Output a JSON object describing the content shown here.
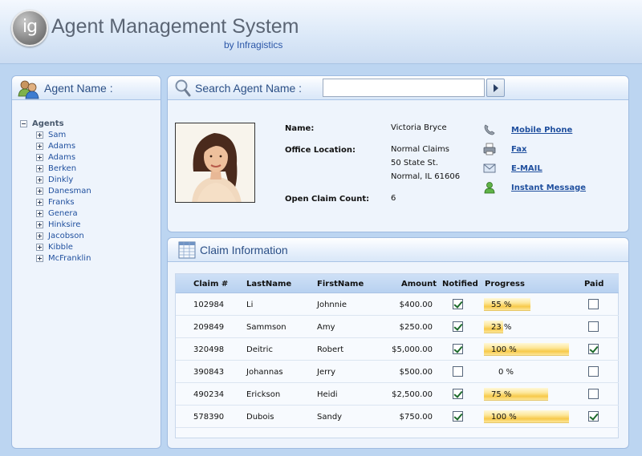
{
  "header": {
    "logo_text": "ig",
    "title": "Agent Management System",
    "subtitle": "by Infragistics"
  },
  "left_panel": {
    "title": "Agent Name :",
    "tree_root": "Agents",
    "agents": [
      "Sam",
      "Adams",
      "Adams",
      "Berken",
      "Dinkly",
      "Danesman",
      "Franks",
      "Genera",
      "Hinksire",
      "Jacobson",
      "Kibble",
      "McFranklin"
    ]
  },
  "search": {
    "title": "Search Agent Name :",
    "value": "",
    "placeholder": ""
  },
  "agent": {
    "name_label": "Name:",
    "name": "Victoria Bryce",
    "office_label": "Office Location:",
    "office_line1": "Normal Claims",
    "office_line2": "50 State St.",
    "office_line3": "Normal, IL 61606",
    "claims_label": "Open Claim Count:",
    "claims": "6"
  },
  "contacts": [
    {
      "label": "Mobile Phone",
      "icon": "phone-icon"
    },
    {
      "label": "Fax",
      "icon": "fax-icon"
    },
    {
      "label": "E-MAIL",
      "icon": "email-icon"
    },
    {
      "label": "Instant Message",
      "icon": "instant-message-icon"
    }
  ],
  "claims": {
    "title": "Claim Information",
    "columns": [
      "Claim #",
      "LastName",
      "FirstName",
      "Amount",
      "Notified",
      "Progress",
      "Paid"
    ],
    "rows": [
      {
        "claim": "102984",
        "last": "Li",
        "first": "Johnnie",
        "amount": "$400.00",
        "notified": true,
        "progress": 55,
        "progress_text": "55 %",
        "paid": false
      },
      {
        "claim": "209849",
        "last": "Sammson",
        "first": "Amy",
        "amount": "$250.00",
        "notified": true,
        "progress": 23,
        "progress_text": "23 %",
        "paid": false
      },
      {
        "claim": "320498",
        "last": "Deitric",
        "first": "Robert",
        "amount": "$5,000.00",
        "notified": true,
        "progress": 100,
        "progress_text": "100 %",
        "paid": true
      },
      {
        "claim": "390843",
        "last": "Johannas",
        "first": "Jerry",
        "amount": "$500.00",
        "notified": false,
        "progress": 0,
        "progress_text": "0 %",
        "paid": false
      },
      {
        "claim": "490234",
        "last": "Erickson",
        "first": "Heidi",
        "amount": "$2,500.00",
        "notified": true,
        "progress": 75,
        "progress_text": "75 %",
        "paid": false
      },
      {
        "claim": "578390",
        "last": "Dubois",
        "first": "Sandy",
        "amount": "$750.00",
        "notified": true,
        "progress": 100,
        "progress_text": "100 %",
        "paid": true
      }
    ]
  },
  "colors": {
    "accent": "#2b4f86",
    "link": "#1f4f9e",
    "progress": "#f7c94a"
  }
}
